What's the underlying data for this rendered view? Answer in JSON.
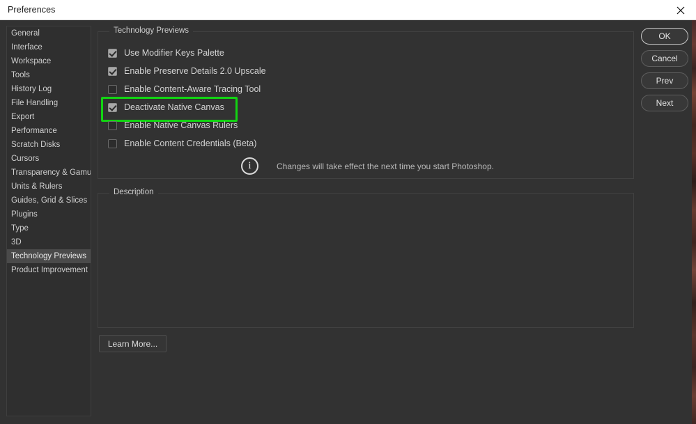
{
  "window": {
    "title": "Preferences",
    "close_icon": "close-icon"
  },
  "colors": {
    "highlight": "#12d412",
    "titlebar_bg": "#ffffff",
    "dialog_bg": "#323232",
    "selected_item_bg": "#4a4a4a"
  },
  "sidebar": {
    "items": [
      {
        "label": "General",
        "selected": false
      },
      {
        "label": "Interface",
        "selected": false
      },
      {
        "label": "Workspace",
        "selected": false
      },
      {
        "label": "Tools",
        "selected": false
      },
      {
        "label": "History Log",
        "selected": false
      },
      {
        "label": "File Handling",
        "selected": false
      },
      {
        "label": "Export",
        "selected": false
      },
      {
        "label": "Performance",
        "selected": false
      },
      {
        "label": "Scratch Disks",
        "selected": false
      },
      {
        "label": "Cursors",
        "selected": false
      },
      {
        "label": "Transparency & Gamut",
        "selected": false
      },
      {
        "label": "Units & Rulers",
        "selected": false
      },
      {
        "label": "Guides, Grid & Slices",
        "selected": false
      },
      {
        "label": "Plugins",
        "selected": false
      },
      {
        "label": "Type",
        "selected": false
      },
      {
        "label": "3D",
        "selected": false
      },
      {
        "label": "Technology Previews",
        "selected": true
      },
      {
        "label": "Product Improvement",
        "selected": false
      }
    ]
  },
  "technology_previews": {
    "legend": "Technology Previews",
    "options": [
      {
        "label": "Use Modifier Keys Palette",
        "checked": true,
        "highlighted": false
      },
      {
        "label": "Enable Preserve Details 2.0 Upscale",
        "checked": true,
        "highlighted": false
      },
      {
        "label": "Enable Content-Aware Tracing Tool",
        "checked": false,
        "highlighted": false
      },
      {
        "label": "Deactivate Native Canvas",
        "checked": true,
        "highlighted": true
      },
      {
        "label": "Enable Native Canvas Rulers",
        "checked": false,
        "highlighted": false
      },
      {
        "label": "Enable Content Credentials (Beta)",
        "checked": false,
        "highlighted": false
      }
    ],
    "note": {
      "icon": "info-icon",
      "glyph": "i",
      "text": "Changes will take effect the next time you start Photoshop."
    }
  },
  "description": {
    "legend": "Description",
    "body": ""
  },
  "learn_more": {
    "label": "Learn More..."
  },
  "buttons": [
    {
      "label": "OK",
      "primary": true
    },
    {
      "label": "Cancel",
      "primary": false
    },
    {
      "label": "Prev",
      "primary": false
    },
    {
      "label": "Next",
      "primary": false
    }
  ]
}
